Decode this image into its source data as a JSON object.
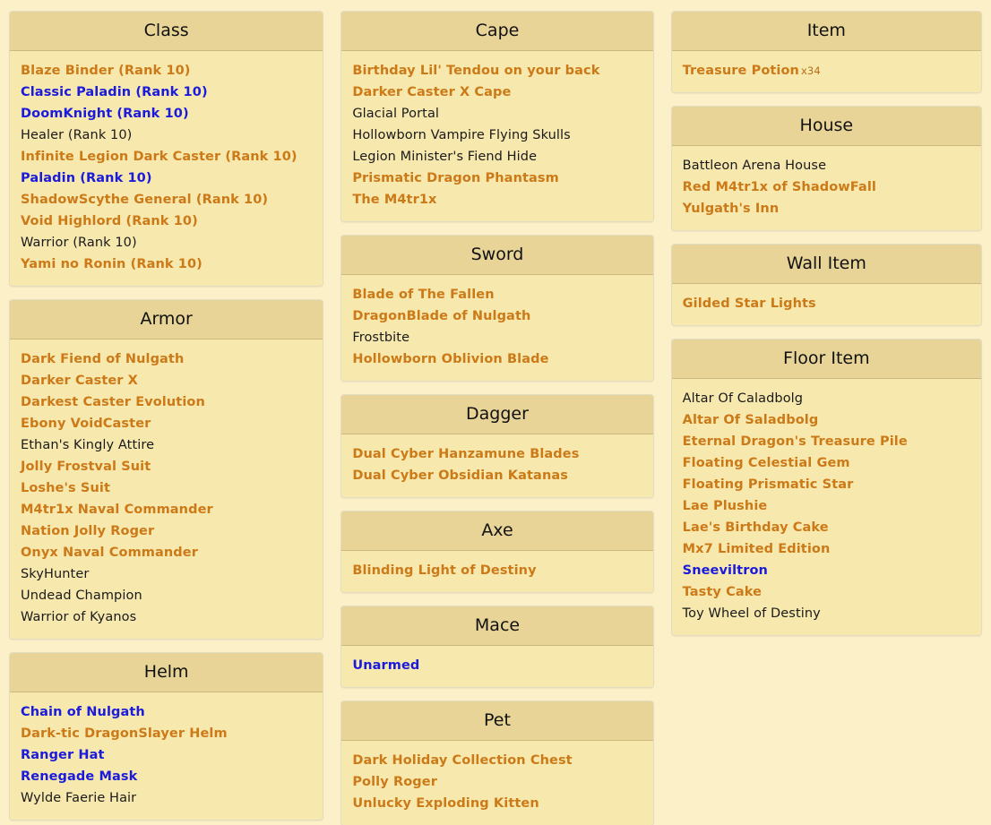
{
  "theme": {
    "page_background": "#fcf0c9",
    "panel_background": "#f7e8ae",
    "panel_header_background": "#e7d496",
    "panel_border": "#e3dcc4",
    "header_divider": "#cbb97f",
    "color_common": "#1a1a1a",
    "color_rare": "#1b1bdb",
    "color_epic": "#cc7a18",
    "color_quantity": "#b8701a"
  },
  "columns": [
    {
      "name": "left-column",
      "panels": [
        {
          "title": "Class",
          "slug": "class",
          "entries": [
            {
              "label": "Blaze Binder (Rank 10)",
              "rarity": "epic"
            },
            {
              "label": "Classic Paladin (Rank 10)",
              "rarity": "rare"
            },
            {
              "label": "DoomKnight (Rank 10)",
              "rarity": "rare"
            },
            {
              "label": "Healer (Rank 10)",
              "rarity": "common"
            },
            {
              "label": "Infinite Legion Dark Caster (Rank 10)",
              "rarity": "epic"
            },
            {
              "label": "Paladin (Rank 10)",
              "rarity": "rare"
            },
            {
              "label": "ShadowScythe General (Rank 10)",
              "rarity": "epic"
            },
            {
              "label": "Void Highlord (Rank 10)",
              "rarity": "epic"
            },
            {
              "label": "Warrior (Rank 10)",
              "rarity": "common"
            },
            {
              "label": "Yami no Ronin (Rank 10)",
              "rarity": "epic"
            }
          ]
        },
        {
          "title": "Armor",
          "slug": "armor",
          "entries": [
            {
              "label": "Dark Fiend of Nulgath",
              "rarity": "epic"
            },
            {
              "label": "Darker Caster X",
              "rarity": "epic"
            },
            {
              "label": "Darkest Caster Evolution",
              "rarity": "epic"
            },
            {
              "label": "Ebony VoidCaster",
              "rarity": "epic"
            },
            {
              "label": "Ethan's Kingly Attire",
              "rarity": "common"
            },
            {
              "label": "Jolly Frostval Suit",
              "rarity": "epic"
            },
            {
              "label": "Loshe's Suit",
              "rarity": "epic"
            },
            {
              "label": "M4tr1x Naval Commander",
              "rarity": "epic"
            },
            {
              "label": "Nation Jolly Roger",
              "rarity": "epic"
            },
            {
              "label": "Onyx Naval Commander",
              "rarity": "epic"
            },
            {
              "label": "SkyHunter",
              "rarity": "common"
            },
            {
              "label": "Undead Champion",
              "rarity": "common"
            },
            {
              "label": "Warrior of Kyanos",
              "rarity": "common"
            }
          ]
        },
        {
          "title": "Helm",
          "slug": "helm",
          "entries": [
            {
              "label": "Chain of Nulgath",
              "rarity": "rare"
            },
            {
              "label": "Dark-tic DragonSlayer Helm",
              "rarity": "epic"
            },
            {
              "label": "Ranger Hat",
              "rarity": "rare"
            },
            {
              "label": "Renegade Mask",
              "rarity": "rare"
            },
            {
              "label": "Wylde Faerie Hair",
              "rarity": "common"
            }
          ]
        }
      ]
    },
    {
      "name": "middle-column",
      "panels": [
        {
          "title": "Cape",
          "slug": "cape",
          "entries": [
            {
              "label": "Birthday Lil' Tendou on your back",
              "rarity": "epic"
            },
            {
              "label": "Darker Caster X Cape",
              "rarity": "epic"
            },
            {
              "label": "Glacial Portal",
              "rarity": "common"
            },
            {
              "label": "Hollowborn Vampire Flying Skulls",
              "rarity": "common"
            },
            {
              "label": "Legion Minister's Fiend Hide",
              "rarity": "common"
            },
            {
              "label": "Prismatic Dragon Phantasm",
              "rarity": "epic"
            },
            {
              "label": "The M4tr1x",
              "rarity": "epic"
            }
          ]
        },
        {
          "title": "Sword",
          "slug": "sword",
          "entries": [
            {
              "label": "Blade of The Fallen",
              "rarity": "epic"
            },
            {
              "label": "DragonBlade of Nulgath",
              "rarity": "epic"
            },
            {
              "label": "Frostbite",
              "rarity": "common"
            },
            {
              "label": "Hollowborn Oblivion Blade",
              "rarity": "epic"
            }
          ]
        },
        {
          "title": "Dagger",
          "slug": "dagger",
          "entries": [
            {
              "label": "Dual Cyber Hanzamune Blades",
              "rarity": "epic"
            },
            {
              "label": "Dual Cyber Obsidian Katanas",
              "rarity": "epic"
            }
          ]
        },
        {
          "title": "Axe",
          "slug": "axe",
          "entries": [
            {
              "label": "Blinding Light of Destiny",
              "rarity": "epic"
            }
          ]
        },
        {
          "title": "Mace",
          "slug": "mace",
          "entries": [
            {
              "label": "Unarmed",
              "rarity": "rare"
            }
          ]
        },
        {
          "title": "Pet",
          "slug": "pet",
          "entries": [
            {
              "label": "Dark Holiday Collection Chest",
              "rarity": "epic"
            },
            {
              "label": "Polly Roger",
              "rarity": "epic"
            },
            {
              "label": "Unlucky Exploding Kitten",
              "rarity": "epic"
            }
          ]
        }
      ]
    },
    {
      "name": "right-column",
      "panels": [
        {
          "title": "Item",
          "slug": "item",
          "entries": [
            {
              "label": "Treasure Potion",
              "rarity": "epic",
              "quantity": "x34"
            }
          ]
        },
        {
          "title": "House",
          "slug": "house",
          "entries": [
            {
              "label": "Battleon Arena House",
              "rarity": "common"
            },
            {
              "label": "Red M4tr1x of ShadowFall",
              "rarity": "epic"
            },
            {
              "label": "Yulgath's Inn",
              "rarity": "epic"
            }
          ]
        },
        {
          "title": "Wall Item",
          "slug": "wall-item",
          "entries": [
            {
              "label": "Gilded Star Lights",
              "rarity": "epic"
            }
          ]
        },
        {
          "title": "Floor Item",
          "slug": "floor-item",
          "entries": [
            {
              "label": "Altar Of Caladbolg",
              "rarity": "common"
            },
            {
              "label": "Altar Of Saladbolg",
              "rarity": "epic"
            },
            {
              "label": "Eternal Dragon's Treasure Pile",
              "rarity": "epic"
            },
            {
              "label": "Floating Celestial Gem",
              "rarity": "epic"
            },
            {
              "label": "Floating Prismatic Star",
              "rarity": "epic"
            },
            {
              "label": "Lae Plushie",
              "rarity": "epic"
            },
            {
              "label": "Lae's Birthday Cake",
              "rarity": "epic"
            },
            {
              "label": "Mx7 Limited Edition",
              "rarity": "epic"
            },
            {
              "label": "Sneeviltron",
              "rarity": "rare"
            },
            {
              "label": "Tasty Cake",
              "rarity": "epic"
            },
            {
              "label": "Toy Wheel of Destiny",
              "rarity": "common"
            }
          ]
        }
      ]
    }
  ]
}
